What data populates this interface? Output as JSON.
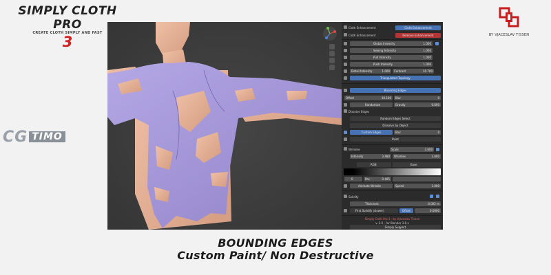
{
  "brand": {
    "title": "SIMPLY CLOTH PRO",
    "subtitle": "CREATE CLOTH SIMPLY AND FAST",
    "version": "3"
  },
  "author": {
    "name": "BY VJACESLAV TISSEN"
  },
  "watermark": {
    "text": "CG",
    "tag": "TIMO"
  },
  "panel": {
    "r1_label": "Cloth Enhancement",
    "r1_button": "Cloth Enhancement",
    "r2_label": "Cloth Enhancement",
    "r2_button": "Remove Enhancement",
    "global_label": "Global Intensity",
    "global_value": "1.000",
    "sewing_label": "Sewing Intensity",
    "sewing_value": "1.000",
    "pull_label": "Pull Intensity",
    "pull_value": "1.000",
    "push_label": "Push Intensity",
    "push_value": "1.000",
    "detail_label": "Detail Intensity",
    "detail_value": "1.000",
    "contrast_label": "Contrast",
    "contrast_value": "10.700",
    "triangulated": "Triangulated Topology",
    "bounding_edges": "Bounding Edges",
    "offset_label": "Offset",
    "offset_value": "10.100",
    "blur_label": "Blur",
    "blur_value": "0",
    "randomize_label": "Randomize",
    "gravity_label": "Gravity",
    "gravity_value": "0.600",
    "dissolve_edges": "Dissolve Edges",
    "random_edges_select": "Random Edges Select",
    "dissolve_by_object": "Dissolve by Object",
    "custom_edges": "Custom Edges",
    "blur2_label": "Blur",
    "blur2_value": "0",
    "paint": "Paint",
    "wrinkles_label": "Wrinkles",
    "scale_label": "Scale",
    "scale_value": "3.000",
    "intensity_label": "Intensity",
    "intensity_value": "3.480",
    "wrinkles_val_label": "Wrinkles",
    "wrinkles_val": "1.000",
    "grad_mode": "RGB",
    "grad_interp": "Ease",
    "stop_index": "0",
    "pos_label": "Pos",
    "pos_value": "0.405",
    "animate_label": "Animate Wrinkle",
    "speed_label": "Speed",
    "speed_value": "1.000",
    "solidify_label": "Solidify",
    "thickness_label": "Thickness",
    "thickness_value": "0.002 m",
    "first_solidify": "First Solidify (slower)",
    "offset2_label": "Offset",
    "offset2_value": "0.0000",
    "footer_title": "Simply Cloth Pro 3 - by Vjaceslav Tissen",
    "footer_version": "v. 3.0 - for Blender 3.6.x",
    "support": "Simply Support"
  },
  "caption": {
    "line1": "BOUNDING EDGES",
    "line2": "Custom Paint/ Non Destructive"
  },
  "colors": {
    "accent": "#4772b3",
    "remove": "#b33434",
    "cloth": "#a79ad8",
    "skin": "#e8b49a",
    "brand_red": "#d42020"
  },
  "icons": [
    "blender-logo-icon",
    "author-logo-icon",
    "axis-gizmo-icon",
    "settings-icon",
    "wrinkle-icon",
    "solidify-icon"
  ]
}
